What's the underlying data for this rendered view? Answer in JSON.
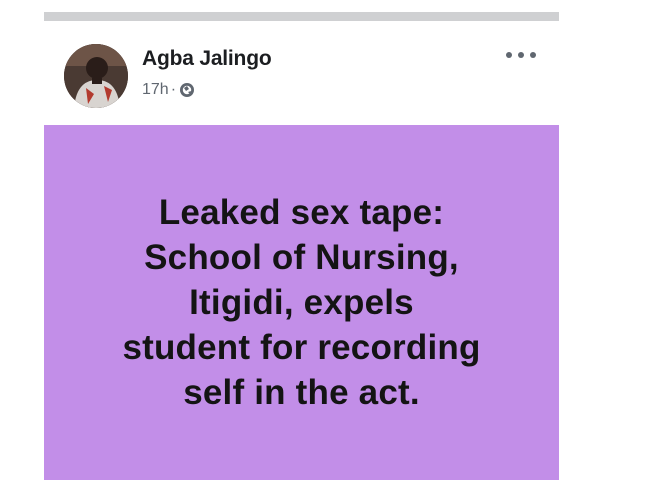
{
  "post": {
    "author_name": "Agba Jalingo",
    "timestamp": "17h",
    "separator": "·",
    "privacy_icon": "globe-icon",
    "more_icon": "more-options-icon",
    "banner": {
      "background_color": "#c28ee8",
      "text_color": "#141414",
      "lines": [
        "Leaked sex tape:",
        "School of Nursing,",
        "Itigidi, expels",
        "student for recording",
        "self in the act."
      ]
    }
  }
}
